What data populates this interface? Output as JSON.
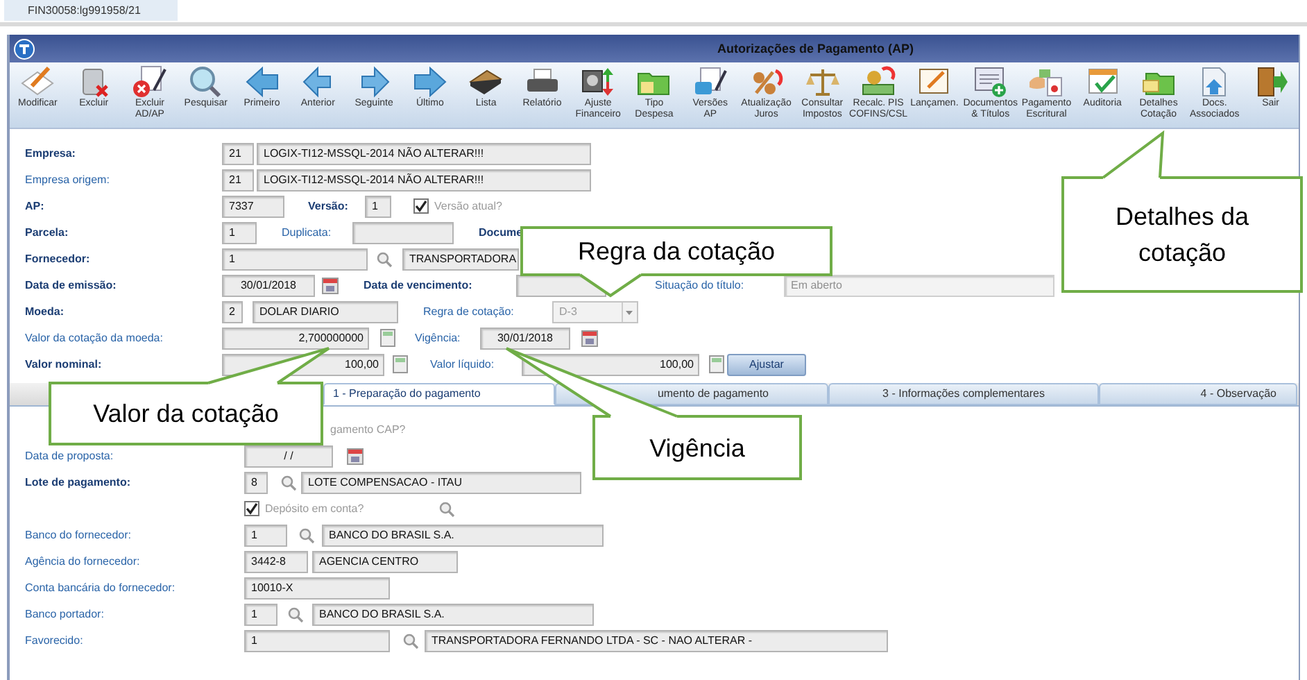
{
  "tab_strip": {
    "label": "FIN30058:lg991958/21"
  },
  "window": {
    "title": "Autorizações de Pagamento (AP)"
  },
  "toolbar": [
    {
      "label": "Modificar"
    },
    {
      "label": "Excluir"
    },
    {
      "label": "Excluir\nAD/AP"
    },
    {
      "label": "Pesquisar"
    },
    {
      "label": "Primeiro"
    },
    {
      "label": "Anterior"
    },
    {
      "label": "Seguinte"
    },
    {
      "label": "Último"
    },
    {
      "label": "Lista"
    },
    {
      "label": "Relatório"
    },
    {
      "label": "Ajuste\nFinanceiro"
    },
    {
      "label": "Tipo\nDespesa"
    },
    {
      "label": "Versões\nAP"
    },
    {
      "label": "Atualização\nJuros"
    },
    {
      "label": "Consultar\nImpostos"
    },
    {
      "label": "Recalc. PIS\nCOFINS/CSL"
    },
    {
      "label": "Lançamen."
    },
    {
      "label": "Documentos\n& Títulos"
    },
    {
      "label": "Pagamento\nEscritural"
    },
    {
      "label": "Auditoria"
    },
    {
      "label": "Detalhes\nCotação"
    },
    {
      "label": "Docs.\nAssociados"
    },
    {
      "label": "Sair"
    }
  ],
  "header_form": [
    {
      "label": "Empresa:",
      "bold": true,
      "items": [
        {
          "kind": "field",
          "value": "21",
          "disabled": false
        },
        {
          "kind": "field",
          "value": "LOGIX-TI12-MSSQL-2014 NÃO ALTERAR!!!",
          "disabled": false
        }
      ]
    },
    {
      "label": "Empresa origem:",
      "bold": false,
      "items": [
        {
          "kind": "field",
          "value": "21",
          "disabled": false
        },
        {
          "kind": "field",
          "value": "LOGIX-TI12-MSSQL-2014 NÃO ALTERAR!!!",
          "disabled": false
        }
      ]
    },
    {
      "label": "AP:",
      "bold": true,
      "items": [
        {
          "kind": "field",
          "value": "7337",
          "disabled": false
        },
        {
          "kind": "label",
          "text": "Versão:",
          "bold": true
        },
        {
          "kind": "field",
          "value": "1",
          "disabled": false
        },
        {
          "kind": "checkbox",
          "text": "Versão atual?",
          "checked": true,
          "disabled": true
        }
      ]
    },
    {
      "label": "Parcela:",
      "bold": true,
      "items": [
        {
          "kind": "field",
          "value": "1",
          "disabled": false
        },
        {
          "kind": "label",
          "text": "Duplicata:",
          "bold": false
        },
        {
          "kind": "field",
          "disabled": false
        },
        {
          "kind": "label",
          "text": "Docume",
          "bold": true
        }
      ]
    },
    {
      "label": "Fornecedor:",
      "bold": true,
      "items": [
        {
          "kind": "field",
          "value": "1",
          "disabled": false
        },
        {
          "kind": "search"
        },
        {
          "kind": "field",
          "value": "TRANSPORTADORA",
          "disabled": false
        }
      ]
    },
    {
      "label": "Data de emissão:",
      "bold": true,
      "items": [
        {
          "kind": "field",
          "value": "30/01/2018",
          "disabled": false
        },
        {
          "kind": "calendar"
        },
        {
          "kind": "label",
          "text": "Data de vencimento:",
          "bold": true
        },
        {
          "kind": "field",
          "disabled": false
        },
        {
          "kind": "label",
          "text": "Situação do título:",
          "bold": false
        },
        {
          "kind": "field",
          "value": "Em aberto",
          "disabled": true
        }
      ]
    },
    {
      "label": "Moeda:",
      "bold": true,
      "items": [
        {
          "kind": "field",
          "value": "2",
          "disabled": false
        },
        {
          "kind": "field",
          "value": "DOLAR DIARIO",
          "disabled": false
        },
        {
          "kind": "label",
          "text": "Regra de cotação:",
          "bold": false
        },
        {
          "kind": "select",
          "value": "D-3",
          "disabled": true
        }
      ]
    },
    {
      "label": "Valor da cotação da moeda:",
      "bold": false,
      "items": [
        {
          "kind": "field",
          "value": "2,700000000",
          "disabled": false
        },
        {
          "kind": "calc"
        },
        {
          "kind": "label",
          "text": "Vigência:",
          "bold": false
        },
        {
          "kind": "field",
          "value": "30/01/2018",
          "disabled": false
        },
        {
          "kind": "calendar"
        }
      ]
    },
    {
      "label": "Valor nominal:",
      "bold": true,
      "items": [
        {
          "kind": "field",
          "value": "100,00",
          "disabled": false
        },
        {
          "kind": "calc"
        },
        {
          "kind": "label",
          "text": "Valor líquido:",
          "bold": false
        },
        {
          "kind": "field",
          "value": "100,00",
          "disabled": false
        },
        {
          "kind": "calc"
        },
        {
          "kind": "button",
          "text": "Ajustar"
        }
      ]
    }
  ],
  "tabs": [
    {
      "label": "1 - Preparação do pagamento",
      "selected": true
    },
    {
      "label": "umento de pagamento",
      "selected": false
    },
    {
      "label": "3 - Informações complementares",
      "selected": false
    },
    {
      "label": "4 - Observação",
      "selected": false
    }
  ],
  "tab_content": [
    {
      "items": [
        {
          "kind": "note",
          "text": "gamento CAP?"
        }
      ]
    },
    {
      "label": "Data de proposta:",
      "bold": false,
      "items": [
        {
          "kind": "field",
          "value": "/ /",
          "disabled": false
        },
        {
          "kind": "calendar"
        }
      ]
    },
    {
      "label": "Lote de pagamento:",
      "bold": true,
      "items": [
        {
          "kind": "field",
          "value": "8",
          "disabled": false
        },
        {
          "kind": "search"
        },
        {
          "kind": "field",
          "value": "LOTE COMPENSACAO  - ITAU",
          "disabled": false
        }
      ]
    },
    {
      "items": [
        {
          "kind": "checkbox",
          "text": "Depósito em conta?",
          "checked": true,
          "disabled": true
        },
        {
          "kind": "search"
        }
      ]
    },
    {
      "label": "Banco do fornecedor:",
      "bold": false,
      "items": [
        {
          "kind": "field",
          "value": "1",
          "disabled": false
        },
        {
          "kind": "search"
        },
        {
          "kind": "field",
          "value": "BANCO DO BRASIL S.A.",
          "disabled": false
        }
      ]
    },
    {
      "label": "Agência do fornecedor:",
      "bold": false,
      "items": [
        {
          "kind": "field",
          "value": "3442-8",
          "disabled": false
        },
        {
          "kind": "field",
          "value": "AGENCIA CENTRO",
          "disabled": false
        }
      ]
    },
    {
      "label": "Conta bancária do fornecedor:",
      "bold": false,
      "items": [
        {
          "kind": "field",
          "value": "10010-X",
          "disabled": false
        }
      ]
    },
    {
      "label": "Banco portador:",
      "bold": false,
      "items": [
        {
          "kind": "field",
          "value": "1",
          "disabled": false
        },
        {
          "kind": "search"
        },
        {
          "kind": "field",
          "value": "BANCO DO BRASIL S.A.",
          "disabled": false
        }
      ]
    },
    {
      "label": "Favorecido:",
      "bold": false,
      "items": [
        {
          "kind": "field",
          "value": "1",
          "disabled": false
        },
        {
          "kind": "search"
        },
        {
          "kind": "field",
          "value": "TRANSPORTADORA FERNANDO LTDA - SC - NAO ALTERAR -",
          "disabled": false
        }
      ]
    }
  ],
  "callouts": [
    {
      "text": "Regra da cotação"
    },
    {
      "text": "Detalhes da cotação"
    },
    {
      "text": "Valor da cotação"
    },
    {
      "text": "Vigência"
    }
  ]
}
